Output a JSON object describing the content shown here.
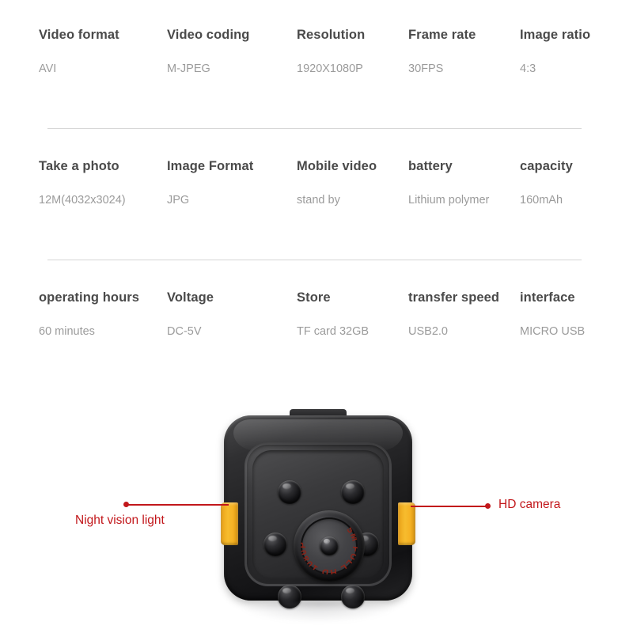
{
  "spec_table": {
    "rows": [
      {
        "cells": [
          {
            "label": "Video format",
            "value": "AVI"
          },
          {
            "label": "Video coding",
            "value": "M-JPEG"
          },
          {
            "label": "Resolution",
            "value": "1920X1080P"
          },
          {
            "label": "Frame rate",
            "value": "30FPS"
          },
          {
            "label": "Image ratio",
            "value": "4:3"
          }
        ],
        "divider": true
      },
      {
        "cells": [
          {
            "label": "Take a photo",
            "value": "12M(4032x3024)"
          },
          {
            "label": "Image Format",
            "value": "JPG"
          },
          {
            "label": "Mobile video",
            "value": "stand by"
          },
          {
            "label": "battery",
            "value": "Lithium polymer"
          },
          {
            "label": "capacity",
            "value": "160mAh"
          }
        ],
        "divider": true
      },
      {
        "cells": [
          {
            "label": "operating hours",
            "value": "60 minutes"
          },
          {
            "label": "Voltage",
            "value": "DC-5V"
          },
          {
            "label": "Store",
            "value": "TF card 32GB"
          },
          {
            "label": "transfer speed",
            "value": "USB2.0"
          },
          {
            "label": "interface",
            "value": "MICRO USB"
          }
        ],
        "divider": false
      }
    ]
  },
  "product_image": {
    "lens_text": "5M FULL HD 1080P",
    "lens_text_segments": [
      "5M",
      "FULL",
      "HD",
      "1080P"
    ]
  },
  "callouts": {
    "left": {
      "label": "Night vision light"
    },
    "right": {
      "label": "HD camera"
    }
  },
  "colors": {
    "label_text": "#4a4a4a",
    "value_text": "#9b9b9b",
    "divider": "#d6d6d6",
    "callout_red": "#c2171b",
    "lens_text_red": "#8c2418",
    "accent_yellow": "#f5b224",
    "body_black": "#1d1d1f",
    "background": "#ffffff"
  }
}
